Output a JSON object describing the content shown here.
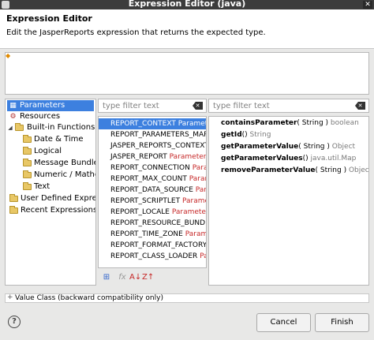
{
  "window": {
    "title": "Expression Editor (java)"
  },
  "header": {
    "title": "Expression Editor",
    "description": "Edit the JasperReports expression that returns the expected type."
  },
  "tree": {
    "items": [
      {
        "label": "Parameters"
      },
      {
        "label": "Resources"
      },
      {
        "label": "Built-in Functions"
      },
      {
        "label": "Date & Time"
      },
      {
        "label": "Logical"
      },
      {
        "label": "Message Bundles"
      },
      {
        "label": "Numeric / Mathem"
      },
      {
        "label": "Text"
      },
      {
        "label": "User Defined Express"
      },
      {
        "label": "Recent Expressions"
      }
    ]
  },
  "filters": {
    "left_placeholder": "type filter text",
    "right_placeholder": "type filter text"
  },
  "list": {
    "items": [
      {
        "name": "REPORT_CONTEXT",
        "type": "Parameter"
      },
      {
        "name": "REPORT_PARAMETERS_MAP",
        "type": "P"
      },
      {
        "name": "JASPER_REPORTS_CONTEXT",
        "type": "P"
      },
      {
        "name": "JASPER_REPORT",
        "type": "Parameter J"
      },
      {
        "name": "REPORT_CONNECTION",
        "type": "Parame"
      },
      {
        "name": "REPORT_MAX_COUNT",
        "type": "Parame"
      },
      {
        "name": "REPORT_DATA_SOURCE",
        "type": "Param"
      },
      {
        "name": "REPORT_SCRIPTLET",
        "type": "Paramete"
      },
      {
        "name": "REPORT_LOCALE",
        "type": "Parameter L"
      },
      {
        "name": "REPORT_RESOURCE_BUNDLE",
        "type": ""
      },
      {
        "name": "REPORT_TIME_ZONE",
        "type": "Param"
      },
      {
        "name": "REPORT_FORMAT_FACTORY",
        "type": "P"
      },
      {
        "name": "REPORT_CLASS_LOADER",
        "type": "Par"
      }
    ]
  },
  "methods": {
    "items": [
      {
        "name": "containsParameter",
        "args": "( String )",
        "ret": "boolean"
      },
      {
        "name": "getId",
        "args": "()",
        "ret": "String"
      },
      {
        "name": "getParameterValue",
        "args": "( String )",
        "ret": "Object"
      },
      {
        "name": "getParameterValues",
        "args": "()",
        "ret": "java.util.Map"
      },
      {
        "name": "removeParameterValue",
        "args": "( String )",
        "ret": "Object"
      }
    ]
  },
  "value_class": {
    "label": "Value Class (backward compatibility only)"
  },
  "buttons": {
    "cancel": "Cancel",
    "finish": "Finish"
  },
  "icons": {
    "selection": "#3d80df",
    "type_color": "#c62828"
  }
}
